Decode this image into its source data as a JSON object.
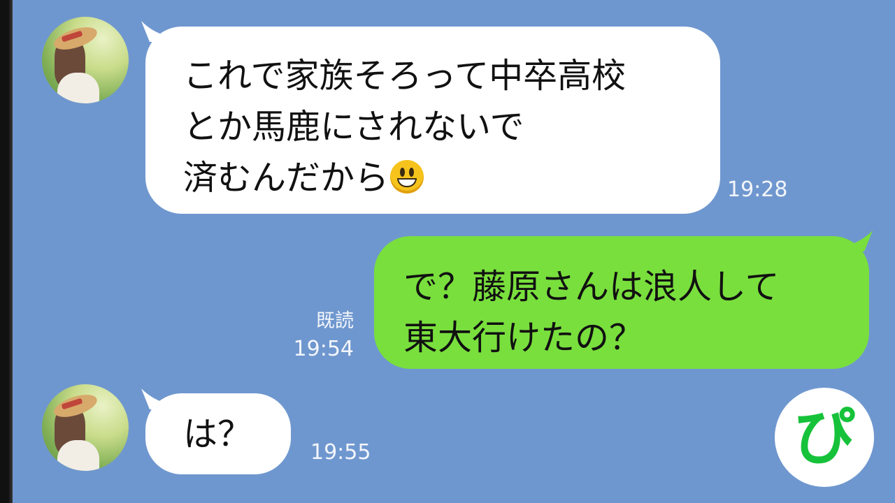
{
  "messages": [
    {
      "sender": "other",
      "lines": [
        "これで家族そろって中卒高校",
        "とか馬鹿にされないで",
        "済むんだから"
      ],
      "emoji": "grinning-face",
      "time": "19:28"
    },
    {
      "sender": "me",
      "lines": [
        "で？藤原さんは浪人して",
        "東大行けたの？"
      ],
      "read": "既読",
      "time": "19:54"
    },
    {
      "sender": "other",
      "lines": [
        "は？"
      ],
      "time": "19:55"
    }
  ],
  "logo": {
    "text": "ぴ",
    "color": "#16c23a"
  },
  "colors": {
    "background": "#6f97cf",
    "bubble_incoming": "#ffffff",
    "bubble_outgoing": "#79df3d"
  }
}
